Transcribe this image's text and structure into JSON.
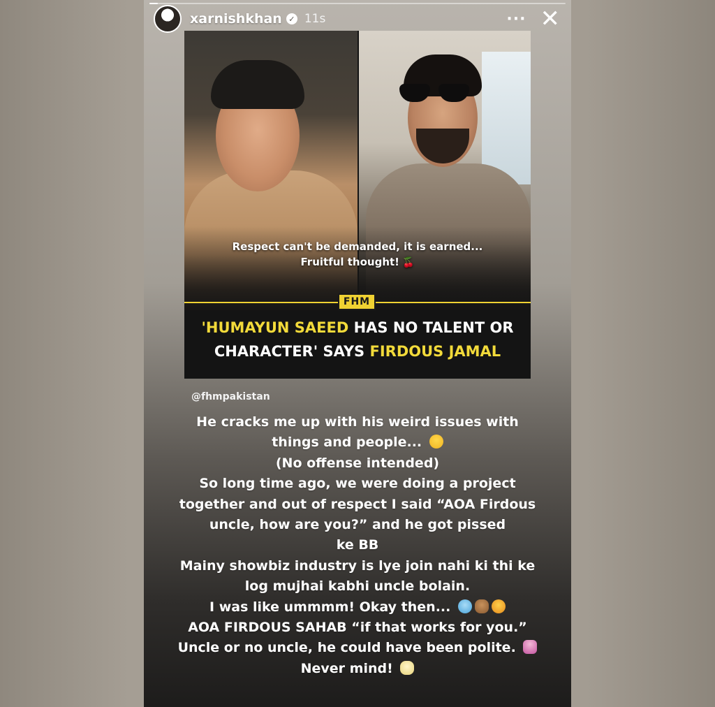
{
  "story": {
    "username": "xarnishkhan",
    "time_ago": "11s",
    "more_label": "···",
    "close_label": "✕",
    "progress_fraction": 0.02
  },
  "post": {
    "quote_line1": "Respect can't be demanded, it is earned...",
    "quote_line2": "Fruitful thought!",
    "logo": "FHM",
    "headline": {
      "part1_highlight": "'HUMAYUN SAEED",
      "part2": " HAS NO TALENT OR",
      "part3": "CHARACTER' SAYS ",
      "part4_highlight": "FIRDOUS JAMAL"
    }
  },
  "mention": "@fhmpakistan",
  "caption": {
    "lines": [
      "He cracks me up with his weird issues with",
      "things and people...",
      "(No offense intended)",
      "So long time ago, we were doing a project",
      "together and out of respect I said “AOA Firdous",
      "uncle, how are you?” and he got pissed",
      "ke BB",
      "Mainy showbiz industry is lye join nahi ki thi ke",
      "log mujhai kabhi uncle bolain.",
      "I was like ummmm! Okay then...",
      "AOA FIRDOUS SAHAB “if that works for you.”",
      "Uncle or no uncle, he could have been polite.",
      "Never mind!"
    ]
  },
  "colors": {
    "highlight_yellow": "#f2da3a",
    "post_background": "#141414"
  },
  "icons": [
    "verified-badge-icon",
    "more-options-icon",
    "close-icon",
    "cherry-emoji-icon"
  ]
}
